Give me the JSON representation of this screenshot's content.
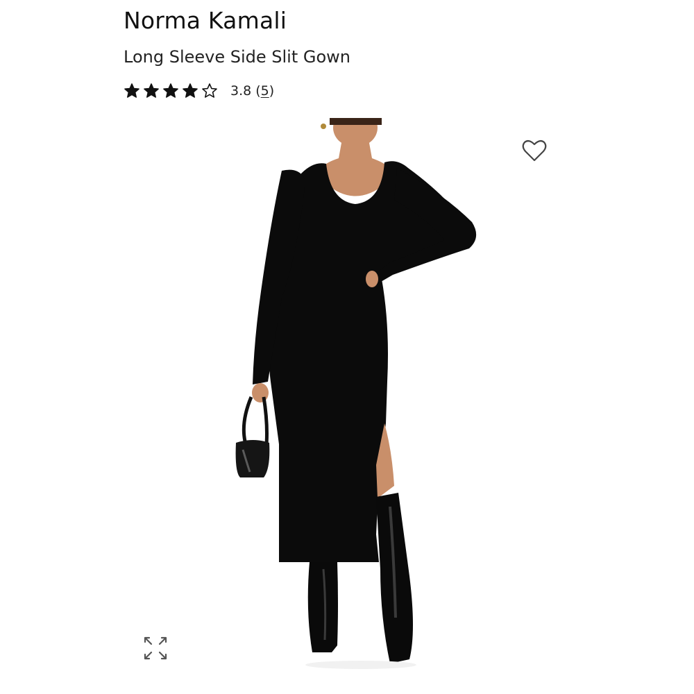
{
  "product": {
    "brand": "Norma Kamali",
    "name": "Long Sleeve Side Slit Gown",
    "rating": {
      "value": 3.8,
      "value_label": "3.8",
      "count": "5",
      "paren_open": "(",
      "paren_close": ")",
      "max_stars": 5
    }
  },
  "icons": {
    "star": "star-icon",
    "wishlist": "heart-outline-icon",
    "expand": "expand-arrows-icon"
  },
  "colors": {
    "text": "#111111",
    "star": "#111111",
    "background": "#ffffff",
    "dress": "#0b0b0b",
    "skin": "#c98f6a"
  }
}
